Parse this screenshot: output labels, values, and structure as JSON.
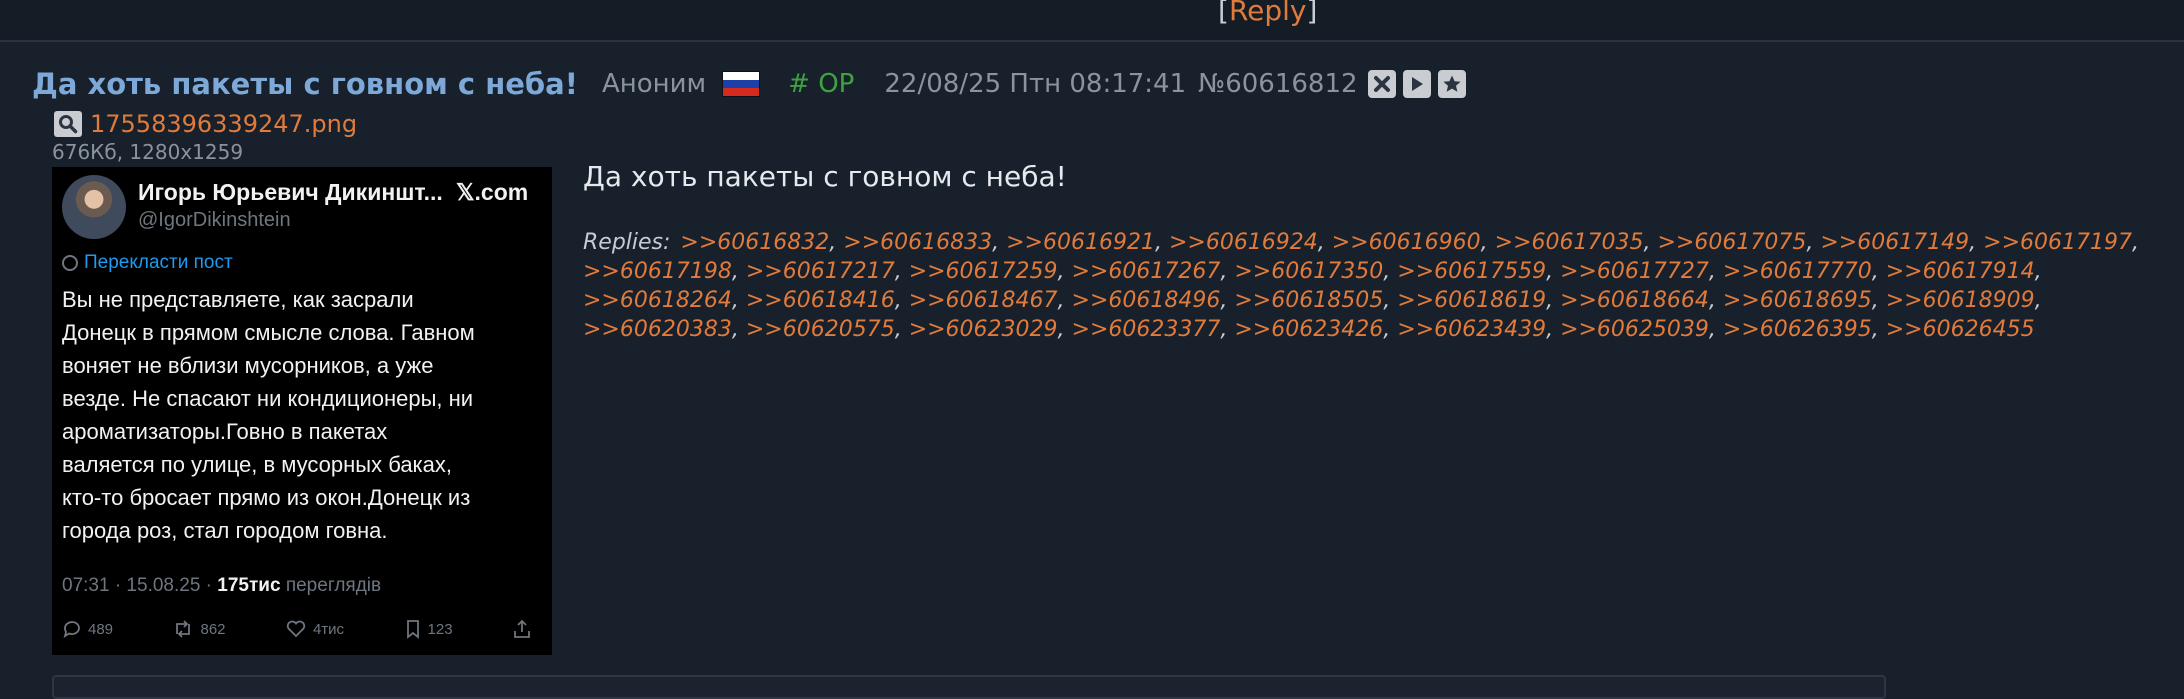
{
  "topbar": {
    "bracket_open": "[",
    "reply_label": "Reply",
    "bracket_close": "]"
  },
  "post": {
    "subject": "Да хоть пакеты с говном с неба!",
    "name": "Аноним",
    "flag_icon": "flag-russia-icon",
    "op_label": "# OP",
    "datetime": "22/08/25 Птн 08:17:41",
    "number": "№60616812",
    "buttons": [
      "close-icon",
      "play-icon",
      "star-icon"
    ],
    "file": {
      "name": "17558396339247.png",
      "meta": "676Кб, 1280x1259"
    },
    "text": "Да хоть пакеты с говном с неба!",
    "replies_label": "Replies:",
    "replies": [
      ">>60616832",
      ">>60616833",
      ">>60616921",
      ">>60616924",
      ">>60616960",
      ">>60617035",
      ">>60617075",
      ">>60617149",
      ">>60617197",
      ">>60617198",
      ">>60617217",
      ">>60617259",
      ">>60617267",
      ">>60617350",
      ">>60617559",
      ">>60617727",
      ">>60617770",
      ">>60617914",
      ">>60618264",
      ">>60618416",
      ">>60618467",
      ">>60618496",
      ">>60618505",
      ">>60618619",
      ">>60618664",
      ">>60618695",
      ">>60618909",
      ">>60620383",
      ">>60620575",
      ">>60623029",
      ">>60623377",
      ">>60623426",
      ">>60623439",
      ">>60625039",
      ">>60626395",
      ">>60626455"
    ]
  },
  "tweet": {
    "author": "Игорь Юрьевич Дикиншт...",
    "site": "𝕏.com",
    "handle": "@IgorDikinshtein",
    "translate": "Перекласти пост",
    "lines": [
      "Вы не представляете, как засрали",
      "Донецк в прямом смысле слова. Гавном",
      "воняет не вблизи мусорников, а уже",
      "везде. Не спасают ни кондиционеры, ни",
      "ароматизаторы.Говно в пакетах",
      "валяется по улице, в мусорных баках,",
      "кто-то бросает прямо из окон.Донецк из",
      "города роз, стал городом говна."
    ],
    "time": "07:31 · 15.08.25 · ",
    "views_count": "175тис",
    "views_label": " переглядів",
    "replies": "489",
    "reposts": "862",
    "likes": "4тис",
    "bookmarks": "123"
  },
  "colors": {
    "background": "#17202b",
    "link": "#e07b3c",
    "subject": "#7da8d8",
    "op": "#3fa23f"
  }
}
